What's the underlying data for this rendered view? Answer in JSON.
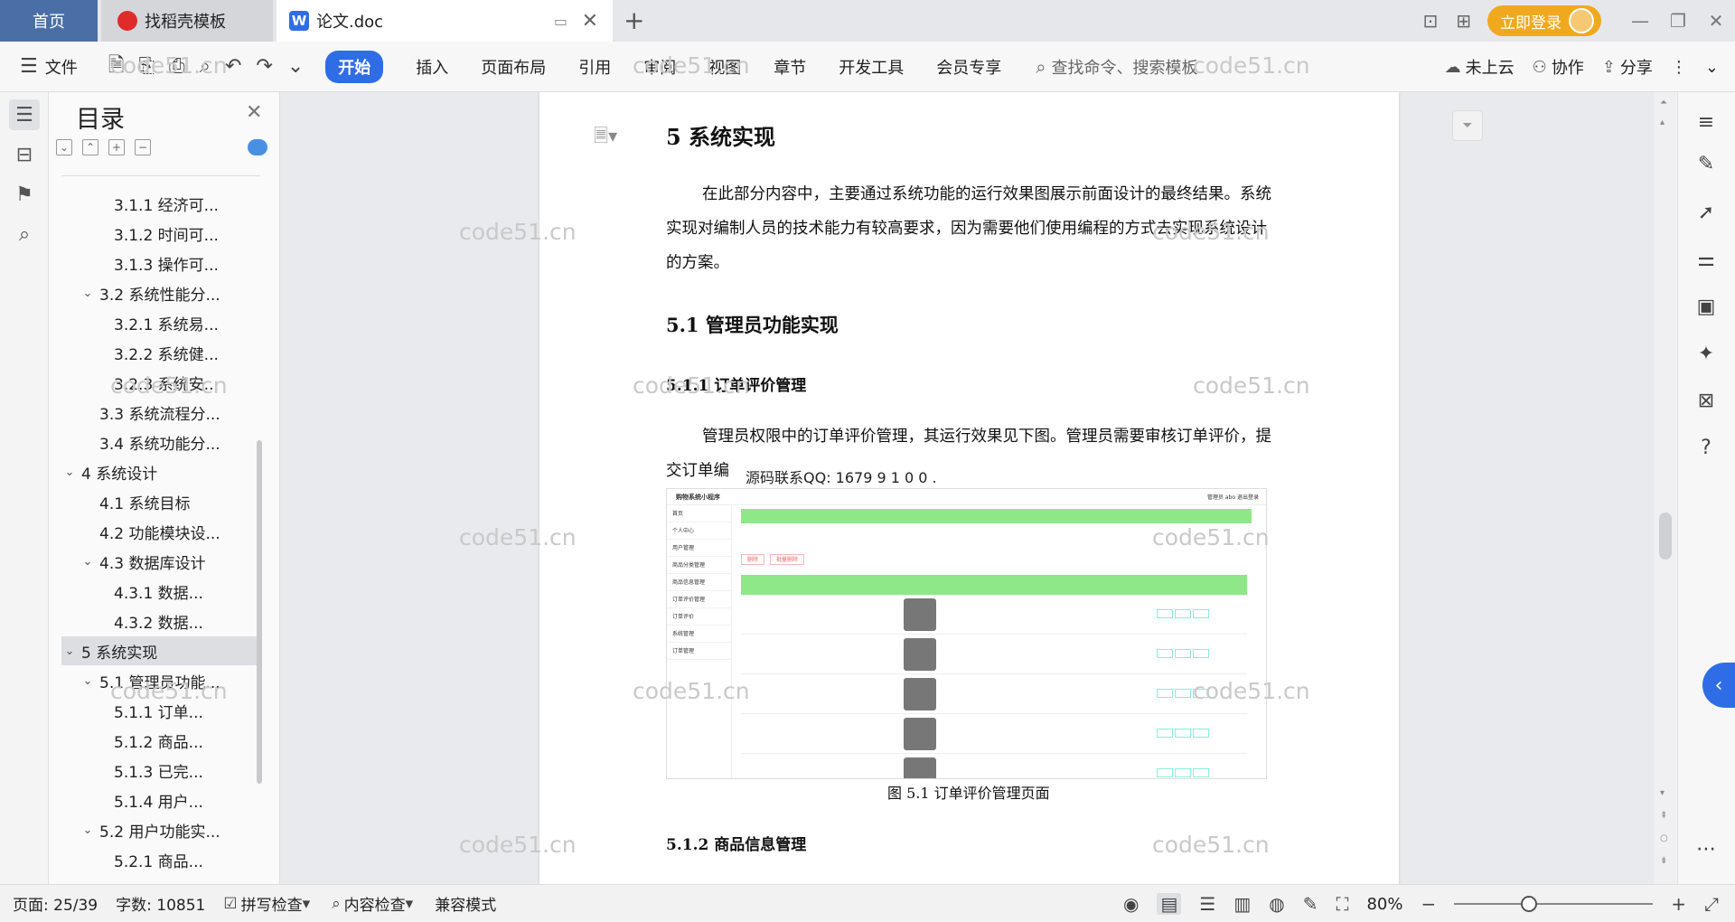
{
  "tabs": {
    "home": "首页",
    "templates": "找稻壳模板",
    "doc": "论文.doc",
    "new_tab": "+"
  },
  "top_right": {
    "login": "立即登录"
  },
  "toolbar": {
    "file": "文件",
    "ribbon": [
      "开始",
      "插入",
      "页面布局",
      "引用",
      "审阅",
      "视图",
      "章节",
      "开发工具",
      "会员专享"
    ],
    "search_placeholder": "查找命令、搜索模板",
    "cloud": "未上云",
    "collab": "协作",
    "share": "分享"
  },
  "toc": {
    "title": "目录",
    "items": [
      {
        "label": "3.1.1 经济可...",
        "level": 3
      },
      {
        "label": "3.1.2 时间可...",
        "level": 3
      },
      {
        "label": "3.1.3 操作可...",
        "level": 3
      },
      {
        "label": "3.2 系统性能分...",
        "level": 2,
        "expanded": true
      },
      {
        "label": "3.2.1 系统易...",
        "level": 3
      },
      {
        "label": "3.2.2 系统健...",
        "level": 3
      },
      {
        "label": "3.2.3 系统安...",
        "level": 3
      },
      {
        "label": "3.3  系统流程分...",
        "level": 2
      },
      {
        "label": "3.4 系统功能分...",
        "level": 2
      },
      {
        "label": "4  系统设计",
        "level": 1,
        "expanded": true
      },
      {
        "label": "4.1 系统目标",
        "level": 2
      },
      {
        "label": "4.2 功能模块设...",
        "level": 2
      },
      {
        "label": "4.3 数据库设计",
        "level": 2,
        "expanded": true
      },
      {
        "label": "4.3.1  数据...",
        "level": 3
      },
      {
        "label": "4.3.2  数据...",
        "level": 3
      },
      {
        "label": "5  系统实现",
        "level": 1,
        "expanded": true,
        "selected": true
      },
      {
        "label": "5.1  管理员功能...",
        "level": 2,
        "expanded": true
      },
      {
        "label": "5.1.1  订单...",
        "level": 3
      },
      {
        "label": "5.1.2  商品...",
        "level": 3
      },
      {
        "label": "5.1.3  已完...",
        "level": 3
      },
      {
        "label": "5.1.4  用户...",
        "level": 3
      },
      {
        "label": "5.2  用户功能实...",
        "level": 2,
        "expanded": true
      },
      {
        "label": "5.2.1  商品...",
        "level": 3
      }
    ]
  },
  "document": {
    "h1": "5  系统实现",
    "para1": "在此部分内容中，主要通过系统功能的运行效果图展示前面设计的最终结果。系统实现对编制人员的技术能力有较高要求，因为需要他们使用编程的方式去实现系统设计的方案。",
    "h2": "5.1  管理员功能实现",
    "h3a": "5.1.1  订单评价管理",
    "para2": "管理员权限中的订单评价管理，其运行效果见下图。管理员需要审核订单评价，提交订单编",
    "overlay_text": "源码联系QQ: 1679 9 1 0 0 .",
    "caption": "图 5.1  订单评价管理页面",
    "h3b": "5.1.2  商品信息管理",
    "screenshot": {
      "app_title": "购物系统小程序",
      "user": "管理员 abo  退出登录",
      "menu": [
        "首页",
        "个人中心",
        "用户管理",
        "商品分类管理",
        "商品信息管理",
        "订单评价管理",
        "订单评价",
        "系统管理",
        "订单管理"
      ],
      "buttons": [
        "删除",
        "批量删除"
      ],
      "row_count": 5
    }
  },
  "watermark": "code51.cn",
  "statusbar": {
    "page": "页面: 25/39",
    "words": "字数: 10851",
    "spell": "拼写检查",
    "content": "内容检查",
    "compat": "兼容模式",
    "zoom": "80%"
  }
}
